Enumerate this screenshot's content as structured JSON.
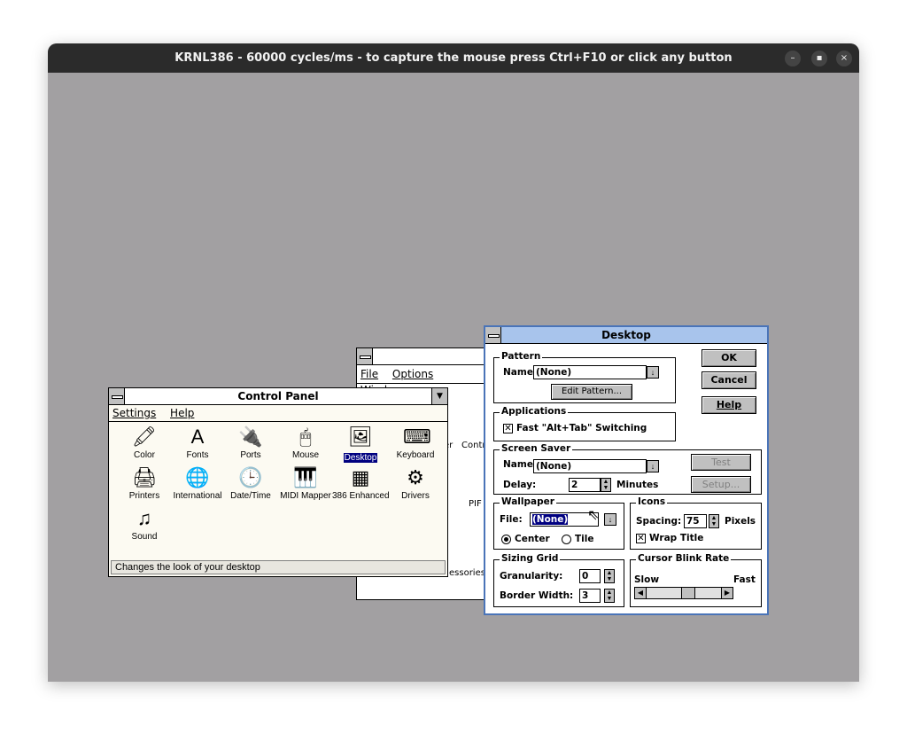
{
  "host": {
    "title": "KRNL386 - 60000 cycles/ms - to capture the mouse press Ctrl+F10 or click any button",
    "buttons": [
      "–",
      "▪",
      "×"
    ]
  },
  "program_manager": {
    "menu": [
      "File",
      "Options",
      "Window"
    ],
    "partial_labels": [
      "er",
      "Contro",
      "PIF",
      "essories"
    ]
  },
  "control_panel": {
    "title": "Control Panel",
    "menu": [
      "Settings",
      "Help"
    ],
    "icons": [
      {
        "label": "Color",
        "icon": "color-icon",
        "glyph": "🖍"
      },
      {
        "label": "Fonts",
        "icon": "fonts-icon",
        "glyph": "A"
      },
      {
        "label": "Ports",
        "icon": "ports-icon",
        "glyph": "🔌"
      },
      {
        "label": "Mouse",
        "icon": "mouse-icon",
        "glyph": "🖱"
      },
      {
        "label": "Desktop",
        "icon": "desktop-icon",
        "glyph": "🖼"
      },
      {
        "label": "Keyboard",
        "icon": "keyboard-icon",
        "glyph": "⌨"
      },
      {
        "label": "Printers",
        "icon": "printers-icon",
        "glyph": "🖨"
      },
      {
        "label": "International",
        "icon": "globe-icon",
        "glyph": "🌐"
      },
      {
        "label": "Date/Time",
        "icon": "clock-icon",
        "glyph": "🕒"
      },
      {
        "label": "MIDI Mapper",
        "icon": "midi-icon",
        "glyph": "🎹"
      },
      {
        "label": "386 Enhanced",
        "icon": "chip-icon",
        "glyph": "▦"
      },
      {
        "label": "Drivers",
        "icon": "drivers-icon",
        "glyph": "⚙"
      },
      {
        "label": "Sound",
        "icon": "sound-icon",
        "glyph": "♫"
      }
    ],
    "status": "Changes the look of your desktop"
  },
  "desktop_dialog": {
    "title": "Desktop",
    "buttons": {
      "ok": "OK",
      "cancel": "Cancel",
      "help": "Help",
      "test": "Test",
      "setup": "Setup..."
    },
    "pattern": {
      "group": "Pattern",
      "name_label": "Name:",
      "name_value": "(None)",
      "edit_button": "Edit Pattern..."
    },
    "applications": {
      "group": "Applications",
      "fast_switch_label": "Fast \"Alt+Tab\" Switching",
      "checked": true
    },
    "screen_saver": {
      "group": "Screen Saver",
      "name_label": "Name:",
      "name_value": "(None)",
      "delay_label": "Delay:",
      "delay_value": "2",
      "minutes_label": "Minutes"
    },
    "wallpaper": {
      "group": "Wallpaper",
      "file_label": "File:",
      "file_value": "(None)",
      "center_label": "Center",
      "tile_label": "Tile",
      "selected": "Center"
    },
    "icons": {
      "group": "Icons",
      "spacing_label": "Spacing:",
      "spacing_value": "75",
      "pixels_label": "Pixels",
      "wrap_label": "Wrap Title",
      "wrap_checked": true
    },
    "sizing_grid": {
      "group": "Sizing Grid",
      "granularity_label": "Granularity:",
      "granularity_value": "0",
      "border_label": "Border Width:",
      "border_value": "3"
    },
    "cursor_blink": {
      "group": "Cursor Blink Rate",
      "slow_label": "Slow",
      "fast_label": "Fast",
      "rate_fraction": 0.55
    }
  }
}
